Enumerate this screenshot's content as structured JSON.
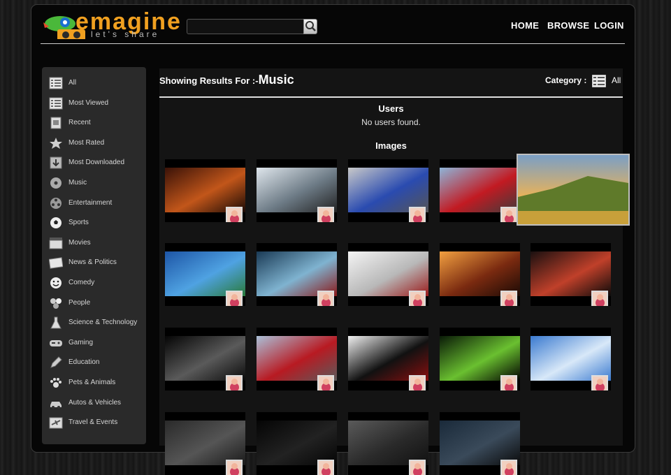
{
  "header": {
    "logo_word": "emagine",
    "logo_tagline": "let's share",
    "search": {
      "value": "",
      "placeholder": ""
    },
    "nav": [
      "HOME",
      "BROWSE",
      "LOGIN"
    ]
  },
  "sidebar": {
    "items": [
      {
        "label": "All",
        "icon": "list-icon"
      },
      {
        "label": "Most Viewed",
        "icon": "list-icon"
      },
      {
        "label": "Recent",
        "icon": "document-icon"
      },
      {
        "label": "Most Rated",
        "icon": "star-icon"
      },
      {
        "label": "Most Downloaded",
        "icon": "download-icon"
      },
      {
        "label": "Music",
        "icon": "disc-icon"
      },
      {
        "label": "Entertainment",
        "icon": "film-reel-icon"
      },
      {
        "label": "Sports",
        "icon": "soccer-ball-icon"
      },
      {
        "label": "Movies",
        "icon": "clapper-icon"
      },
      {
        "label": "News & Politics",
        "icon": "newspaper-icon"
      },
      {
        "label": "Comedy",
        "icon": "smiley-icon"
      },
      {
        "label": "People",
        "icon": "people-icon"
      },
      {
        "label": "Science & Technology",
        "icon": "flask-icon"
      },
      {
        "label": "Gaming",
        "icon": "gamepad-icon"
      },
      {
        "label": "Education",
        "icon": "pencil-icon"
      },
      {
        "label": "Pets & Animals",
        "icon": "paw-icon"
      },
      {
        "label": "Autos & Vehicles",
        "icon": "car-icon"
      },
      {
        "label": "Travel & Events",
        "icon": "plane-icon"
      }
    ]
  },
  "results": {
    "prefix": "Showing Results For :-",
    "query": "Music",
    "category_label": "Category :",
    "category_value": "All",
    "users_heading": "Users",
    "users_message": "No users found.",
    "images_heading": "Images"
  },
  "images": [
    {
      "subject": "fire-lion-wallpaper",
      "palette": [
        "#3a1208",
        "#c2561a",
        "#1a0a05"
      ]
    },
    {
      "subject": "car-on-road-wallpaper",
      "palette": [
        "#dfe6ec",
        "#6d7b86",
        "#222"
      ]
    },
    {
      "subject": "blue-mustang-wallpaper",
      "palette": [
        "#c9c9c9",
        "#2a4bb0",
        "#555"
      ]
    },
    {
      "subject": "red-bmw-wallpaper",
      "palette": [
        "#8eb4d8",
        "#c21a22",
        "#3c3c3c"
      ]
    },
    {
      "subject": "mountain-landscape-popup",
      "palette": [
        "#7a9fc6",
        "#e8b25a",
        "#5f7a2a"
      ]
    },
    {
      "subject": "green-motorbike-wallpaper",
      "palette": [
        "#0b1a12",
        "#68c12e",
        "#05090a"
      ]
    },
    {
      "subject": "floating-islands-wallpaper",
      "palette": [
        "#1d55a6",
        "#4fa2e2",
        "#2a7a3a"
      ]
    },
    {
      "subject": "assassins-creed-group-wallpaper",
      "palette": [
        "#1a3a55",
        "#7fb3d0",
        "#8a1a1a"
      ]
    },
    {
      "subject": "assassins-creed-white-wallpaper",
      "palette": [
        "#f4f4f4",
        "#b8b8b8",
        "#9a1a1a"
      ]
    },
    {
      "subject": "palm-sunset-wallpaper",
      "palette": [
        "#f2a040",
        "#7a2a10",
        "#1a0a05"
      ]
    },
    {
      "subject": "dark-sunset-wallpaper",
      "palette": [
        "#1a1010",
        "#c0402a",
        "#0a0a0a"
      ]
    },
    {
      "subject": "windows7-wallpaper",
      "palette": [
        "#050505",
        "#5a5a5a",
        "#0a0a0a"
      ]
    },
    {
      "subject": "red-car-road-wallpaper",
      "palette": [
        "#aac0d8",
        "#b81a22",
        "#5a5a5a"
      ]
    },
    {
      "subject": "ink-splash-wallpaper",
      "palette": [
        "#f0f0f0",
        "#111",
        "#8a1010"
      ]
    },
    {
      "subject": "green-butterfly-wallpaper",
      "palette": [
        "#0a1a08",
        "#6ac030",
        "#000"
      ]
    },
    {
      "subject": "sky-partial-wallpaper",
      "palette": [
        "#3a7ad0",
        "#d8e8f8",
        "#3a7ad0"
      ]
    },
    {
      "subject": "dark-partial-wallpaper",
      "palette": [
        "#2a2a2a",
        "#555",
        "#1a1a1a"
      ]
    },
    {
      "subject": "black-partial-wallpaper",
      "palette": [
        "#050505",
        "#222",
        "#050505"
      ]
    },
    {
      "subject": "grey-partial-wallpaper",
      "palette": [
        "#5a5a5a",
        "#2a2a2a",
        "#111"
      ]
    },
    {
      "subject": "night-partial-wallpaper",
      "palette": [
        "#1a2a3a",
        "#3a4a5a",
        "#0a0a0a"
      ]
    }
  ],
  "colors": {
    "accent_orange": "#f0a020",
    "sidebar_bg": "#2a2a2a",
    "panel_bg": "#141414"
  }
}
